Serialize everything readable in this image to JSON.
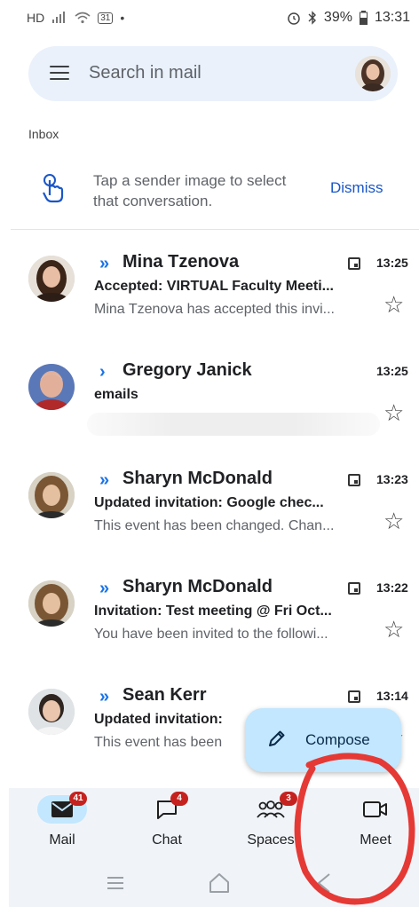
{
  "status_bar": {
    "left_text": "HD",
    "date_badge": "31",
    "battery": "39%",
    "time": "13:31"
  },
  "search": {
    "placeholder": "Search in mail"
  },
  "inbox_label": "Inbox",
  "tip": {
    "text": "Tap a sender image to select that conversation.",
    "dismiss_label": "Dismiss"
  },
  "emails": [
    {
      "sender": "Mina Tzenova",
      "time": "13:25",
      "subject": "Accepted: VIRTUAL Faculty Meeti...",
      "snippet": "Mina Tzenova has accepted this invi...",
      "importance": "»",
      "has_calendar": true
    },
    {
      "sender": "Gregory Janick",
      "time": "13:25",
      "subject": "emails",
      "snippet": "",
      "importance": "›",
      "has_calendar": false
    },
    {
      "sender": "Sharyn McDonald",
      "time": "13:23",
      "subject": "Updated invitation: Google chec...",
      "snippet": "This event has been changed. Chan...",
      "importance": "»",
      "has_calendar": true
    },
    {
      "sender": "Sharyn McDonald",
      "time": "13:22",
      "subject": "Invitation: Test meeting @ Fri Oct...",
      "snippet": "You have been invited to the followi...",
      "importance": "»",
      "has_calendar": true
    },
    {
      "sender": "Sean Kerr",
      "time": "13:14",
      "subject": "Updated invitation:",
      "snippet": "This event has been",
      "importance": "»",
      "has_calendar": true
    }
  ],
  "compose": {
    "label": "Compose"
  },
  "bottom_nav": [
    {
      "label": "Mail",
      "badge": "41",
      "icon": "mail-icon",
      "active": true
    },
    {
      "label": "Chat",
      "badge": "4",
      "icon": "chat-icon",
      "active": false
    },
    {
      "label": "Spaces",
      "badge": "3",
      "icon": "spaces-icon",
      "active": false
    },
    {
      "label": "Meet",
      "badge": "",
      "icon": "video-icon",
      "active": false
    }
  ],
  "colors": {
    "accent": "#1a73e8",
    "search_bg": "#eaf1fb",
    "compose_bg": "#c2e7ff",
    "badge": "#c5221f",
    "annotation": "#e53935"
  }
}
